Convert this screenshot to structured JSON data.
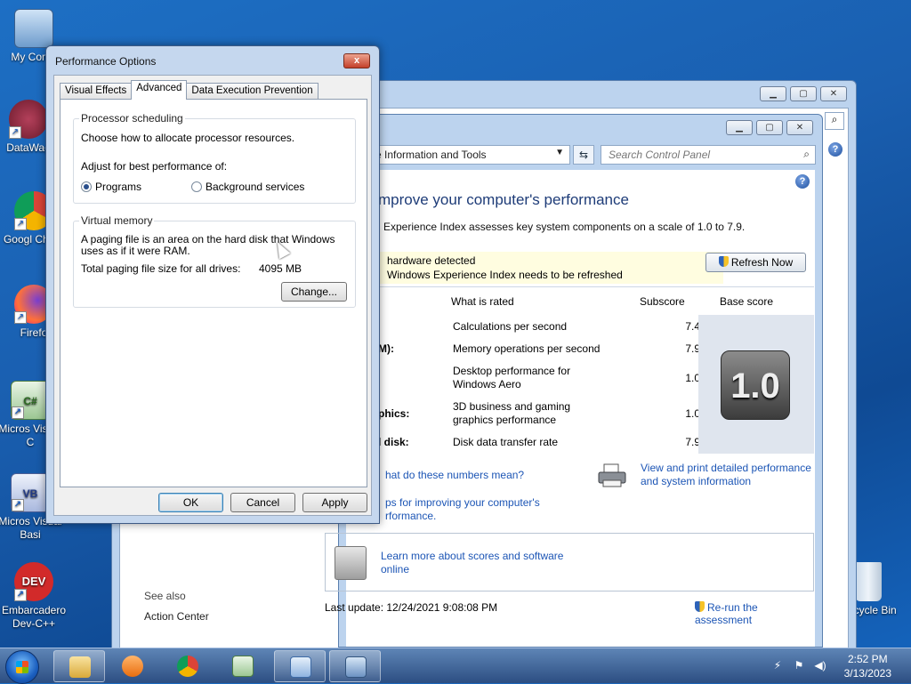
{
  "desktop": {
    "icons": [
      {
        "label": "My Comp"
      },
      {
        "label": "DataWag"
      },
      {
        "label": "Googl Chron"
      },
      {
        "label": "Firefo"
      },
      {
        "label": "Micros Visual C"
      },
      {
        "label": "Micros Visual Basi"
      },
      {
        "label": "Embarcadero Dev-C++"
      },
      {
        "label": "Recycle Bin"
      }
    ]
  },
  "control_panel": {
    "address_text": "nance Information and Tools",
    "search_placeholder": "Search Control Panel",
    "heading": "mprove your computer's performance",
    "intro": "Experience Index assesses key system components on a scale of 1.0 to 7.9.",
    "notice_line1": "hardware detected",
    "notice_line2": "Windows Experience Index needs to be refreshed",
    "refresh_button": "Refresh Now",
    "columns": {
      "what": "What is rated",
      "subscore": "Subscore",
      "base": "Base score"
    },
    "rows": [
      {
        "category": "",
        "what": "Calculations per second",
        "subscore": "7.4"
      },
      {
        "category": "M):",
        "what": "Memory operations per second",
        "subscore": "7.9"
      },
      {
        "category": "",
        "what": "Desktop performance for Windows Aero",
        "subscore": "1.0"
      },
      {
        "category": "phics:",
        "what": "3D business and gaming graphics performance",
        "subscore": "1.0"
      },
      {
        "category": "l disk:",
        "what": "Disk data transfer rate",
        "subscore": "7.9"
      }
    ],
    "base_score": "1.0",
    "link_numbers": "hat do these numbers mean?",
    "link_print": "View and print detailed performance and system information",
    "link_tips": "ps for improving your computer's rformance.",
    "link_learn": "Learn more about scores and software online",
    "last_update": "Last update: 12/24/2021 9:08:08 PM",
    "rerun": "Re-run the assessment",
    "see_also": "See also",
    "action_center": "Action Center"
  },
  "dialog": {
    "title": "Performance Options",
    "close_glyph": "x",
    "tabs": [
      {
        "label": "Visual Effects",
        "active": false
      },
      {
        "label": "Advanced",
        "active": true
      },
      {
        "label": "Data Execution Prevention",
        "active": false
      }
    ],
    "processor": {
      "group_label": "Processor scheduling",
      "description": "Choose how to allocate processor resources.",
      "adjust_label": "Adjust for best performance of:",
      "option_programs": "Programs",
      "option_background": "Background services",
      "selected": "Programs"
    },
    "virtual_memory": {
      "group_label": "Virtual memory",
      "description": "A paging file is an area on the hard disk that Windows uses as if it were RAM.",
      "total_label": "Total paging file size for all drives:",
      "total_value": "4095 MB",
      "change_button": "Change..."
    },
    "buttons": {
      "ok": "OK",
      "cancel": "Cancel",
      "apply": "Apply"
    }
  },
  "taskbar": {
    "time": "2:52 PM",
    "date": "3/13/2023"
  },
  "colors": {
    "accent": "#1e3c78",
    "link": "#1c55b5",
    "notice_bg": "#fffde0"
  }
}
